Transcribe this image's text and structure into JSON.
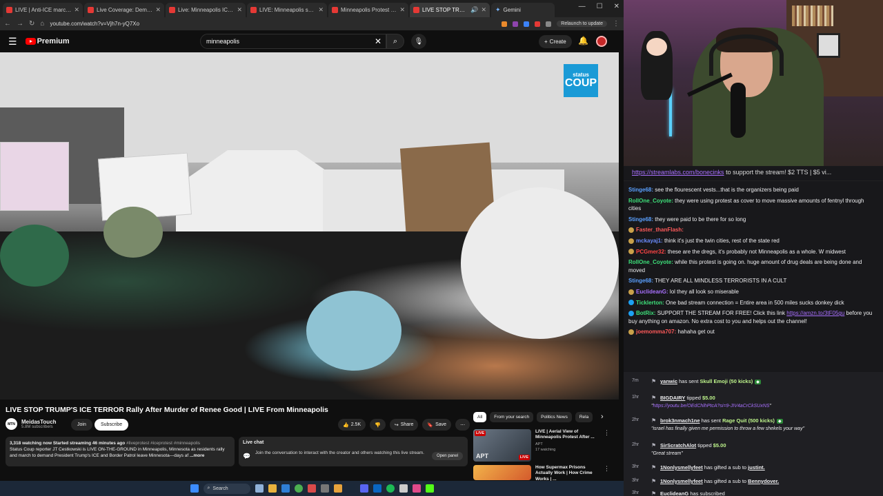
{
  "tabs": [
    {
      "title": "LIVE | Anti-ICE march set to ta"
    },
    {
      "title": "Live Coverage: Demonstrators"
    },
    {
      "title": "Live: Minneapolis ICE shooting"
    },
    {
      "title": "LIVE: Minneapolis shooting ICE"
    },
    {
      "title": "Minneapolis Protest - LIVE on"
    },
    {
      "title": "LIVE STOP TRUMP'S ICE TE"
    }
  ],
  "gemini_tab": "Gemini",
  "url": "youtube.com/watch?v=Vjh7n-yQ7Xo",
  "relaunch": "Relaunch to update",
  "yt": {
    "logo_text": "Premium",
    "search_value": "minneapolis",
    "create_label": "Create"
  },
  "watermark": {
    "line1": "status",
    "line2": "COUP"
  },
  "video": {
    "title": "LIVE STOP TRUMP'S ICE TERROR Rally After Murder of Renee Good | LIVE From Minneapolis",
    "channel": "MeidasTouch",
    "channel_abbr": "MTN",
    "subs": "5.8M subscribers",
    "join": "Join",
    "subscribe": "Subscribe",
    "likes": "2.5K",
    "share": "Share",
    "save": "Save"
  },
  "description": {
    "views": "3,318 watching now  Started streaming 46 minutes ago",
    "tags": "#liveprotest #iceprotest #minneapolis",
    "text": "Status Coup reporter JT Cestkowski is LIVE ON-THE-GROUND in Minneapolis, Minnesota as residents rally and march to demand President Trump's ICE and Border Patrol leave Minnesota—days af",
    "more": "...more"
  },
  "live_chat": {
    "title": "Live chat",
    "text": "Join the conversation to interact with the creator and others watching this live stream.",
    "open_panel": "Open panel"
  },
  "chips": [
    "All",
    "From your search",
    "Politics News",
    "Rela"
  ],
  "recs": [
    {
      "live": "LIVE",
      "thumb_text": "APT",
      "title": "LIVE | Aerial View of Minneapolis Protest After ...",
      "channel": "APT",
      "meta": "17 watching"
    },
    {
      "live": "",
      "thumb_text": "",
      "title": "How Supermax Prisons Actually Work | How Crime Works | ...",
      "channel": "",
      "meta": ""
    }
  ],
  "taskbar": {
    "search": "Search"
  },
  "chat": {
    "pinned_link": "https://streamlabs.com/bonecinks",
    "pinned_rest": " to support the stream! $2 TTS | $5 vi...",
    "messages": [
      {
        "user": "Stinge68",
        "color": "#5aa0ff",
        "text": "see the flourescent vests...that is the organizers being paid",
        "badge": ""
      },
      {
        "user": "RollOne_Coyote",
        "color": "#3ee07a",
        "text": "they were using protest as cover to move massive amounts of fentnyl through cities",
        "badge": ""
      },
      {
        "user": "Stinge68",
        "color": "#5aa0ff",
        "text": "they were paid to be there for so long",
        "badge": ""
      },
      {
        "user": "Faster_thanFlash",
        "color": "#ff5a5a",
        "text": "",
        "badge": "#c9a14a"
      },
      {
        "user": "mckayaj1",
        "color": "#6b8cff",
        "text": "think it's just the twin cities, rest of the state red",
        "badge": "#c9a14a"
      },
      {
        "user": "PCGmer32",
        "color": "#ff4545",
        "text": "these are the dregs, it's probably not Minneapolis as a whole. W midwest",
        "badge": "#c9a14a"
      },
      {
        "user": "RollOne_Coyote",
        "color": "#3ee07a",
        "text": "while this protest is going on. huge amount of drug deals are being done and moved",
        "badge": ""
      },
      {
        "user": "Stinge68",
        "color": "#5aa0ff",
        "text": "THEY ARE ALL MINDLESS TERRORISTS IN A CULT",
        "badge": ""
      },
      {
        "user": "EuclideanG",
        "color": "#a970ff",
        "text": "lol they all look so miserable",
        "badge": "#c9a14a"
      },
      {
        "user": "Ticklerton",
        "color": "#3ee07a",
        "text": "One bad stream connection = Entire area in 500 miles sucks donkey dick",
        "badge": "#1da1f2"
      },
      {
        "user": "BotRix",
        "color": "#3ee07a",
        "text": "SUPPORT THE STREAM FOR FREE! Click this link ",
        "link": "https://amzn.to/3tF05gu",
        "text2": " before you buy anything on amazon. No extra cost to you and helps out the channel!",
        "badge": "#1da1f2"
      },
      {
        "user": "joemomma707",
        "color": "#ff5a5a",
        "text": "hahaha get out",
        "badge": "#c9a14a"
      }
    ]
  },
  "events": [
    {
      "time": "7m",
      "user": "yanwic",
      "mid": " has sent ",
      "hl": "Skull Emoji (50 kicks)",
      "sub": "",
      "amt": ""
    },
    {
      "time": "1hr",
      "user": "BIGDAIRY",
      "mid": " tipped ",
      "hl": "",
      "amt": "$5.00",
      "sub_link": "https://youtu.be/OEdChlhPtcA?si=9-JIV4aCrCkSUxNS"
    },
    {
      "time": "2hr",
      "user": "brok3nmach1ne",
      "mid": " has sent ",
      "hl": "Rage Quit (500 kicks)",
      "sub": "\"israel has finally given me permission to throw a few shekels your way\"",
      "amt": ""
    },
    {
      "time": "2hr",
      "user": "SirScratchAlot",
      "mid": " tipped ",
      "hl": "",
      "amt": "$5.00",
      "sub": "\"Great stream\""
    },
    {
      "time": "3hr",
      "user": "1Nonlysmellyfeet",
      "mid": " has gifted a sub to ",
      "hl": "",
      "target": "justint.",
      "amt": ""
    },
    {
      "time": "3hr",
      "user": "1Nonlysmellyfeet",
      "mid": " has gifted a sub to ",
      "hl": "",
      "target": "Bennydover.",
      "amt": ""
    },
    {
      "time": "3hr",
      "user": "EuclideanG",
      "mid": " has subscribed",
      "hl": "",
      "amt": ""
    }
  ]
}
